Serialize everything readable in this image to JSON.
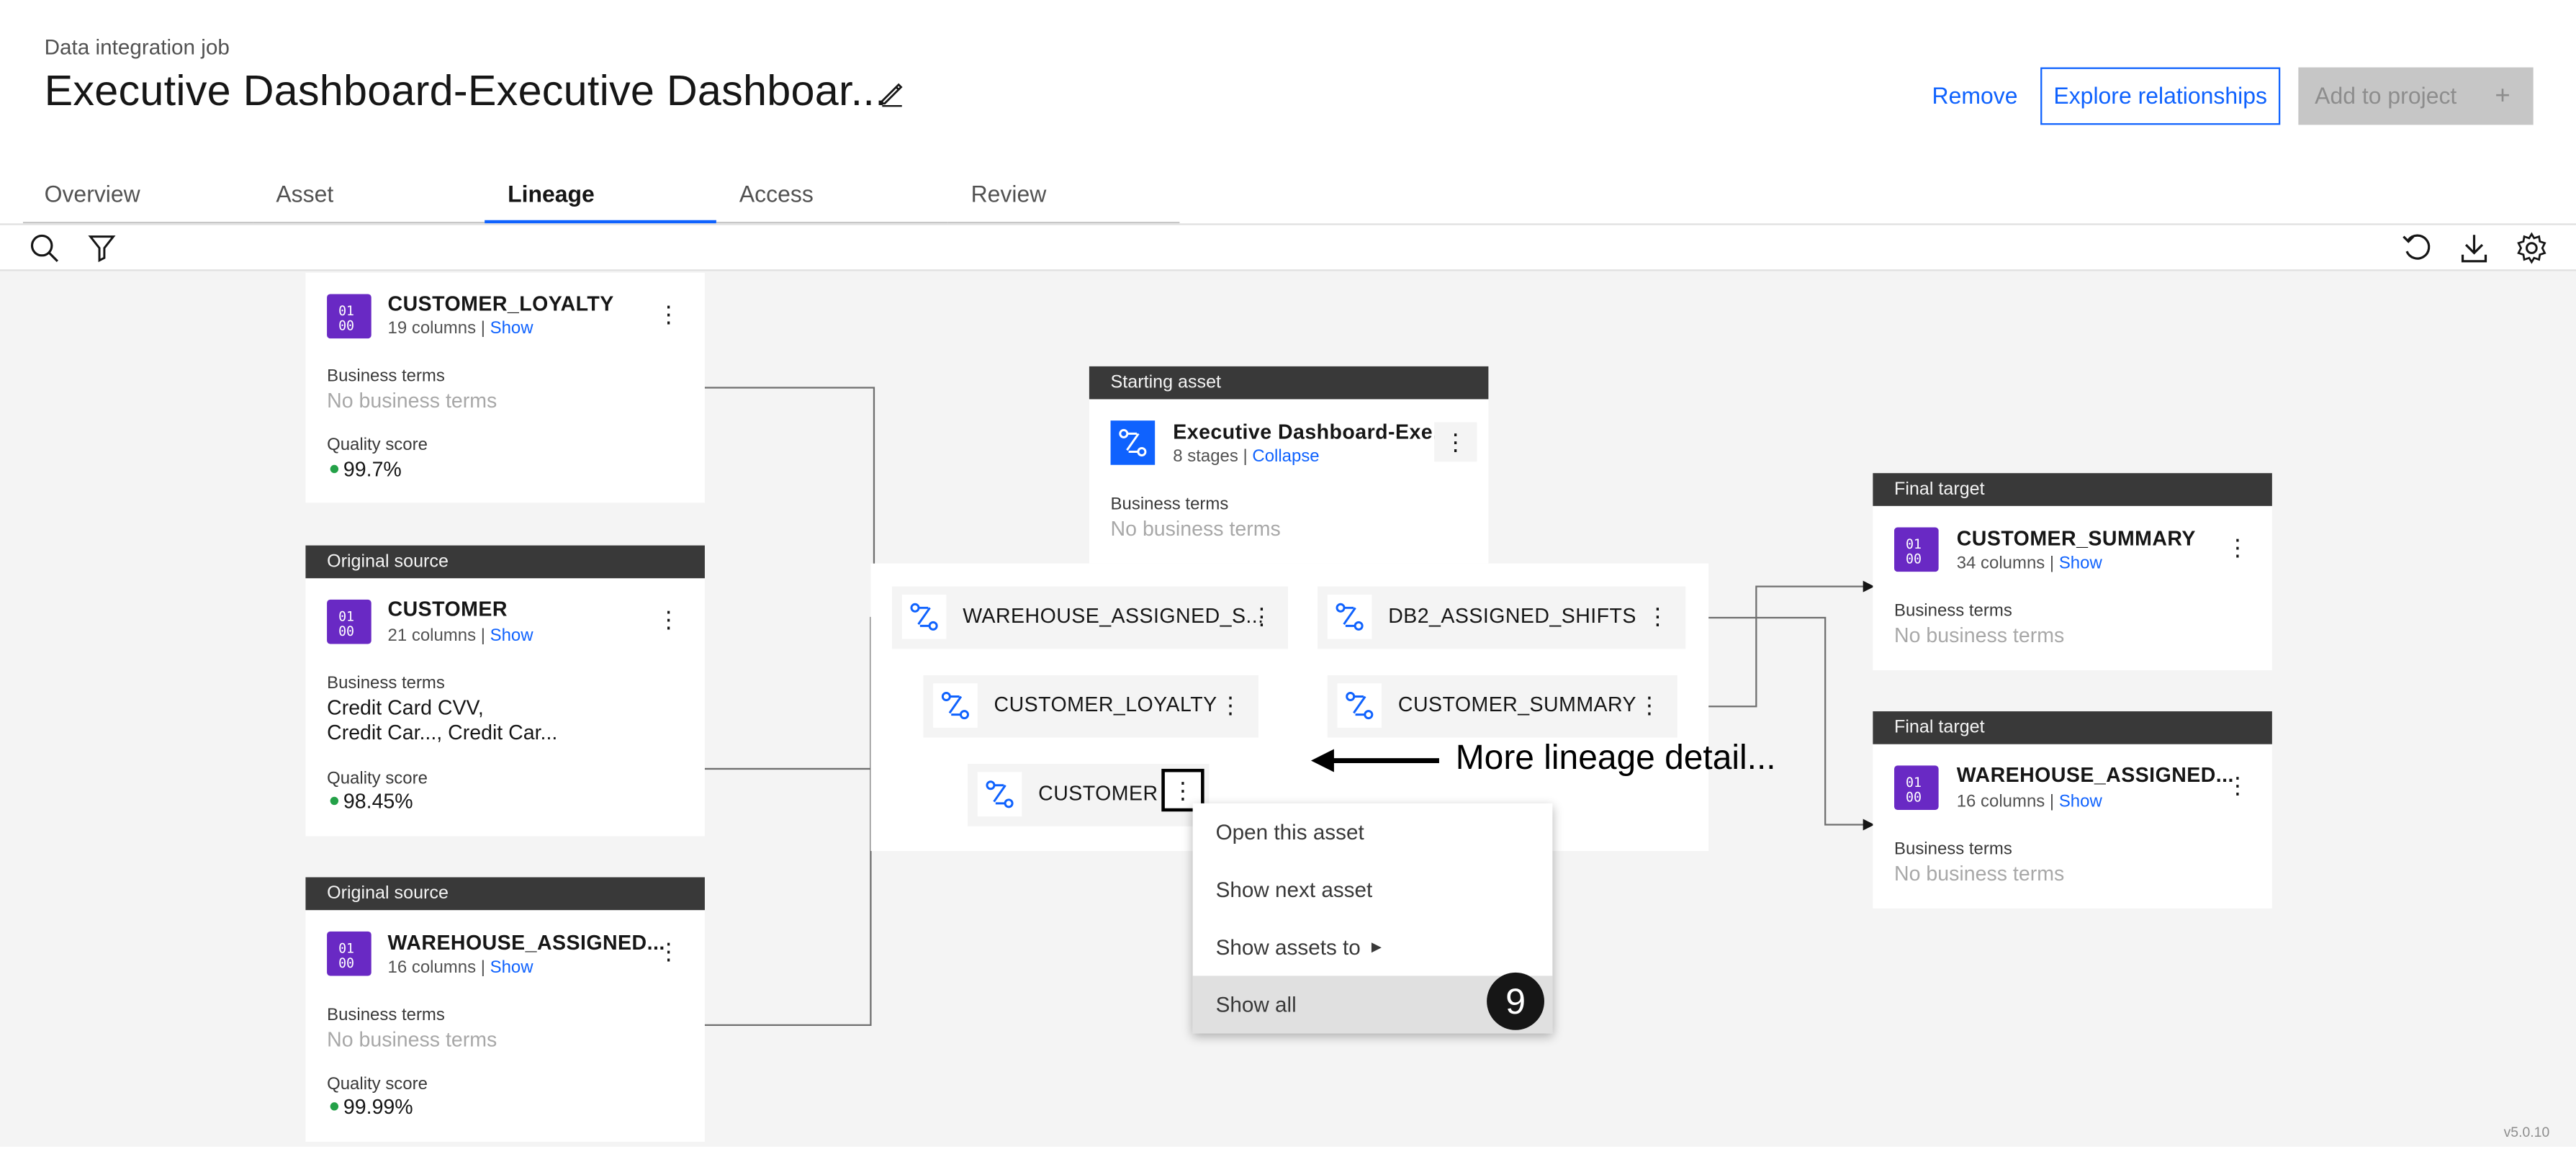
{
  "header": {
    "eyebrow": "Data integration job",
    "title": "Executive Dashboard-Executive Dashboar...",
    "remove_label": "Remove",
    "explore_label": "Explore relationships",
    "add_label": "Add to project",
    "add_plus": "+"
  },
  "tabs": [
    "Overview",
    "Asset",
    "Lineage",
    "Access",
    "Review"
  ],
  "active_tab": "Lineage",
  "sources": [
    {
      "header": "",
      "name": "CUSTOMER_LOYALTY",
      "columns": "19 columns |",
      "show": "Show",
      "terms_label": "Business terms",
      "terms": "No business terms",
      "quality_label": "Quality score",
      "quality": "99.7%"
    },
    {
      "header": "Original source",
      "name": "CUSTOMER",
      "columns": "21 columns |",
      "show": "Show",
      "terms_label": "Business terms",
      "terms_line1": "Credit Card CVV,",
      "terms_line2": "Credit Car..., Credit Car...",
      "quality_label": "Quality score",
      "quality": "98.45%"
    },
    {
      "header": "Original source",
      "name": "WAREHOUSE_ASSIGNED...",
      "columns": "16 columns |",
      "show": "Show",
      "terms_label": "Business terms",
      "terms": "No business terms",
      "quality_label": "Quality score",
      "quality": "99.99%"
    }
  ],
  "starting": {
    "header": "Starting asset",
    "name": "Executive Dashboard-Exe...",
    "stages": "8 stages |",
    "collapse": "Collapse",
    "terms_label": "Business terms",
    "terms": "No business terms"
  },
  "stages": [
    {
      "name": "WAREHOUSE_ASSIGNED_S..."
    },
    {
      "name": "DB2_ASSIGNED_SHIFTS"
    },
    {
      "name": "CUSTOMER_LOYALTY"
    },
    {
      "name": "CUSTOMER_SUMMARY"
    },
    {
      "name": "CUSTOMER"
    }
  ],
  "targets": [
    {
      "header": "Final target",
      "name": "CUSTOMER_SUMMARY",
      "columns": "34 columns |",
      "show": "Show",
      "terms_label": "Business terms",
      "terms": "No business terms"
    },
    {
      "header": "Final target",
      "name": "WAREHOUSE_ASSIGNED...",
      "columns": "16 columns |",
      "show": "Show",
      "terms_label": "Business terms",
      "terms": "No business terms"
    }
  ],
  "menu": [
    "Open this asset",
    "Show next asset",
    "Show assets to",
    "Show all"
  ],
  "annotation": "More lineage detail...",
  "badge": "9",
  "version": "v5.0.10",
  "colors": {
    "accent": "#0f62fe",
    "table_icon": "#6929c4",
    "quality_dot": "#24a148",
    "card_header": "#393939"
  }
}
